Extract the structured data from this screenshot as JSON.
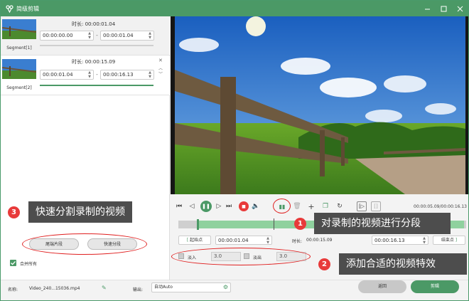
{
  "app": {
    "title": "简级剪辑"
  },
  "segments": [
    {
      "name": "Segment[1]",
      "duration_label": "时长:",
      "duration": "00:00:01.04",
      "start": "00:00:00.00",
      "end": "00:00:01.04"
    },
    {
      "name": "Segment[2]",
      "duration_label": "时长:",
      "duration": "00:00:15.09",
      "start": "00:00:01.04",
      "end": "00:00:16.13"
    }
  ],
  "left_panel": {
    "split_end_label": "尾端片段",
    "quick_split_label": "快速分段",
    "merge_all_label": "合并所有"
  },
  "player": {
    "timecode": "00:00:05.09/00:00:16.13"
  },
  "trim": {
    "start_btn": "起始点",
    "start_time": "00:00:01.04",
    "duration_label": "时长:",
    "duration": "00:00:15.09",
    "end_time": "00:00:16.13",
    "end_btn": "结束点"
  },
  "effects": {
    "fade_in_label": "淡入",
    "fade_in_value": "3.0",
    "fade_out_label": "淡出",
    "fade_out_value": "3.0"
  },
  "bottom": {
    "filename_label": "名称:",
    "filename": "Video_240...15036.mp4",
    "output_label": "输出:",
    "output_value": "自动Auto",
    "back_label": "返回",
    "cut_label": "剪辑"
  },
  "annotations": [
    {
      "num": "1",
      "text": "对录制的视频进行分段"
    },
    {
      "num": "2",
      "text": "添加合适的视频特效"
    },
    {
      "num": "3",
      "text": "快速分割录制的视频"
    }
  ],
  "colors": {
    "accent": "#4b9966",
    "annotation_red": "#e83a3a",
    "callout_bg": "#4d4d4d"
  },
  "playback": {
    "progress": 0.33
  }
}
